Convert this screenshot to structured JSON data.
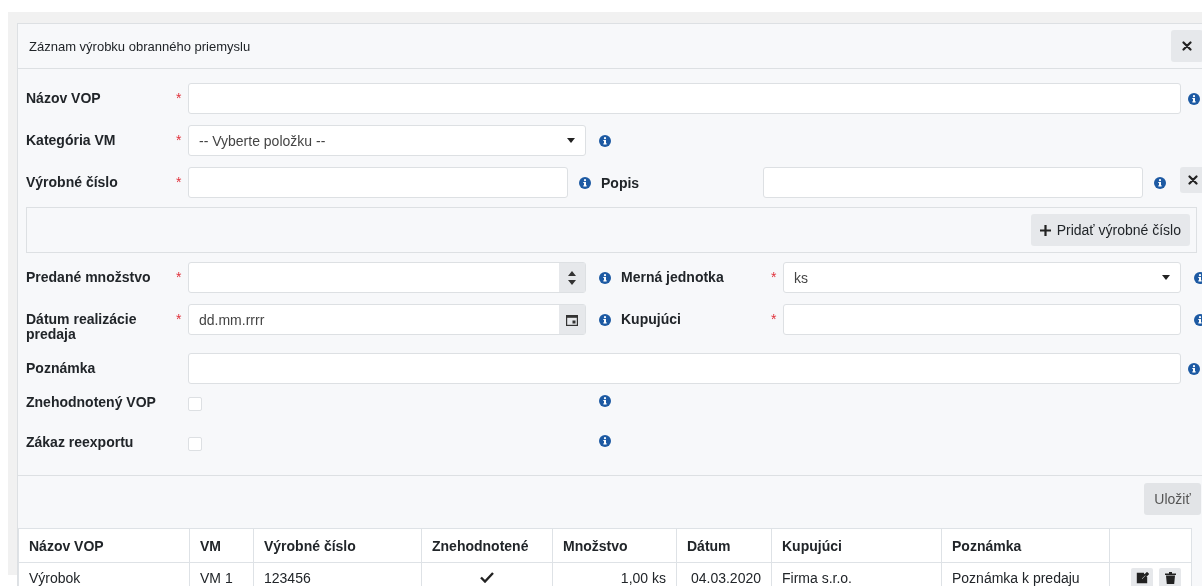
{
  "dialog": {
    "title": "Záznam výrobku obranného priemyslu"
  },
  "top_rows": [
    [
      {
        "kind": "text",
        "label": "Názov VOP",
        "required_mark": "*"
      }
    ],
    [
      {
        "kind": "select",
        "label": "Kategória VM",
        "required_mark": "*",
        "value": "-- Vyberte položku --"
      }
    ]
  ],
  "serial_numbers": {
    "fields": [
      {
        "kind": "text",
        "label": "Výrobné číslo",
        "required_mark": "*"
      },
      {
        "kind": "text",
        "label": "Popis"
      }
    ],
    "add_button": "Pridať výrobné číslo"
  },
  "rows": [
    [
      {
        "kind": "number",
        "label": "Predané množstvo",
        "required_mark": "*"
      },
      {
        "kind": "select",
        "label": "Merná jednotka",
        "required_mark": "*",
        "value": "ks"
      }
    ],
    [
      {
        "kind": "date",
        "label": "Dátum realizácie predaja",
        "required_mark": "*",
        "placeholder": "dd.mm.rrrr"
      },
      {
        "kind": "text",
        "label": "Kupujúci",
        "required_mark": "*"
      }
    ],
    [
      {
        "kind": "text",
        "label": "Poznámka"
      }
    ],
    [
      {
        "kind": "checkbox",
        "label": "Znehodnotený VOP",
        "checked": false
      }
    ],
    [
      {
        "kind": "checkbox",
        "label": "Zákaz reexportu",
        "checked": false
      }
    ]
  ],
  "save_button": "Uložiť",
  "table": {
    "columns": [
      "Názov VOP",
      "VM",
      "Výrobné číslo",
      "Znehodnotené",
      "Množstvo",
      "Dátum",
      "Kupujúci",
      "Poznámka"
    ],
    "rows": [
      {
        "name": "Výrobok",
        "vm": "VM 1",
        "serial": "123456",
        "devalued": true,
        "quantity": "1,00 ks",
        "date": "04.03.2020",
        "buyer": "Firma s.r.o.",
        "note": "Poznámka k predaju"
      }
    ]
  }
}
